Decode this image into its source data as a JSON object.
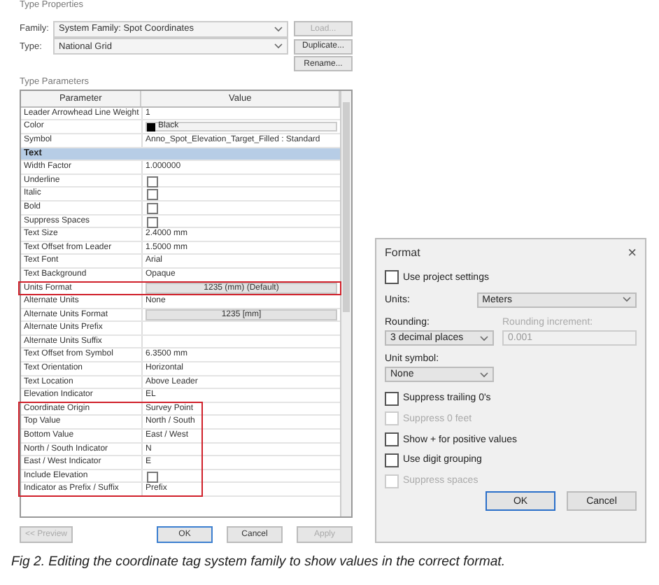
{
  "type_properties": {
    "title": "Type Properties",
    "family": {
      "label": "Family:",
      "value": "System Family: Spot Coordinates"
    },
    "type": {
      "label": "Type:",
      "value": "National Grid"
    },
    "side_buttons": [
      {
        "label": "Load...",
        "disabled": true
      },
      {
        "label": "Duplicate...",
        "disabled": false
      },
      {
        "label": "Rename...",
        "disabled": false
      }
    ],
    "section_label": "Type Parameters",
    "columns": [
      "Parameter",
      "Value"
    ],
    "rows": [
      {
        "kind": "text",
        "parameter": "Leader Arrowhead Line Weight",
        "value": "1"
      },
      {
        "kind": "color",
        "parameter": "Color",
        "value": "Black"
      },
      {
        "kind": "text",
        "parameter": "Symbol",
        "value": "Anno_Spot_Elevation_Target_Filled : Standard"
      },
      {
        "kind": "group",
        "parameter": "Text"
      },
      {
        "kind": "text",
        "parameter": "Width Factor",
        "value": "1.000000"
      },
      {
        "kind": "checkbox",
        "parameter": "Underline",
        "checked": false
      },
      {
        "kind": "checkbox",
        "parameter": "Italic",
        "checked": false
      },
      {
        "kind": "checkbox",
        "parameter": "Bold",
        "checked": false
      },
      {
        "kind": "checkbox",
        "parameter": "Suppress Spaces",
        "checked": false
      },
      {
        "kind": "text",
        "parameter": "Text Size",
        "value": "2.4000 mm"
      },
      {
        "kind": "text",
        "parameter": "Text Offset from Leader",
        "value": "1.5000 mm"
      },
      {
        "kind": "text",
        "parameter": "Text Font",
        "value": "Arial"
      },
      {
        "kind": "text",
        "parameter": "Text Background",
        "value": "Opaque"
      },
      {
        "kind": "button",
        "parameter": "Units Format",
        "value": "1235 (mm) (Default)",
        "highlighted": true
      },
      {
        "kind": "text",
        "parameter": "Alternate Units",
        "value": "None"
      },
      {
        "kind": "button",
        "parameter": "Alternate Units Format",
        "value": "1235 [mm]"
      },
      {
        "kind": "text",
        "parameter": "Alternate Units Prefix"
      },
      {
        "kind": "text",
        "parameter": "Alternate Units Suffix"
      },
      {
        "kind": "text",
        "parameter": "Text Offset from Symbol",
        "value": "6.3500 mm"
      },
      {
        "kind": "text",
        "parameter": "Text Orientation",
        "value": "Horizontal"
      },
      {
        "kind": "text",
        "parameter": "Text Location",
        "value": "Above Leader"
      },
      {
        "kind": "text",
        "parameter": "Elevation Indicator",
        "value": "EL"
      },
      {
        "kind": "text",
        "parameter": "Coordinate Origin",
        "value": "Survey Point",
        "highlighted": true
      },
      {
        "kind": "text",
        "parameter": "Top Value",
        "value": "North / South",
        "highlighted": true
      },
      {
        "kind": "text",
        "parameter": "Bottom Value",
        "value": "East / West",
        "highlighted": true
      },
      {
        "kind": "text",
        "parameter": "North / South Indicator",
        "value": "N",
        "highlighted": true
      },
      {
        "kind": "text",
        "parameter": "East / West Indicator",
        "value": "E",
        "highlighted": true
      },
      {
        "kind": "checkbox",
        "parameter": "Include Elevation",
        "checked": false,
        "highlighted": true
      },
      {
        "kind": "text",
        "parameter": "Indicator as Prefix / Suffix",
        "value": "Prefix",
        "highlighted": true
      }
    ],
    "buttons": [
      {
        "label": "<< Preview",
        "disabled": true,
        "selected": false
      },
      {
        "label": "OK",
        "disabled": false,
        "selected": true
      },
      {
        "label": "Cancel",
        "disabled": false,
        "selected": false
      },
      {
        "label": "Apply",
        "disabled": true,
        "selected": false
      }
    ]
  },
  "format_dialog": {
    "title": "Format",
    "close": "×",
    "use_project_settings": {
      "label": "Use project settings",
      "checked": false
    },
    "units": {
      "label": "Units:",
      "value": "Meters"
    },
    "rounding": {
      "label": "Rounding:",
      "value": "3 decimal places"
    },
    "rounding_increment": {
      "label": "Rounding increment:",
      "value": "0.001",
      "disabled": true
    },
    "unit_symbol": {
      "label": "Unit symbol:",
      "value": "None"
    },
    "options": [
      {
        "label": "Suppress trailing 0's",
        "checked": false,
        "disabled": false
      },
      {
        "label": "Suppress 0 feet",
        "checked": false,
        "disabled": true
      },
      {
        "label": "Show + for positive values",
        "checked": false,
        "disabled": false
      },
      {
        "label": "Use digit grouping",
        "checked": false,
        "disabled": false
      },
      {
        "label": "Suppress spaces",
        "checked": false,
        "disabled": true
      }
    ],
    "buttons": [
      {
        "label": "OK",
        "selected": true
      },
      {
        "label": "Cancel",
        "selected": false
      }
    ]
  },
  "caption": "Fig 2. Editing the coordinate tag system family to show values in the correct format."
}
